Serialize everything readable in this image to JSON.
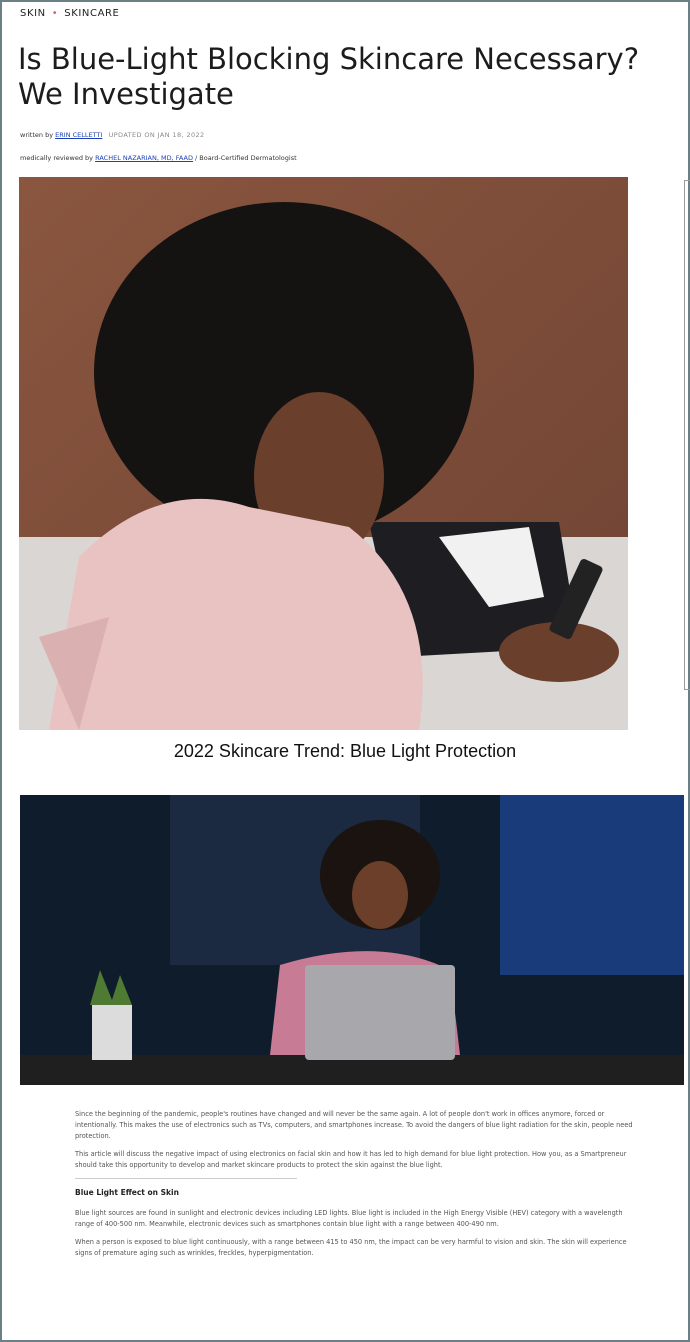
{
  "breadcrumb": {
    "item1": "SKIN",
    "sep": "•",
    "item2": "SKINCARE"
  },
  "article": {
    "title": "Is Blue-Light Blocking Skincare Necessary? We Investigate",
    "written_by_label": "written by",
    "author": "ERIN CELLETTI",
    "updated": "UPDATED ON JAN 18, 2022",
    "reviewed_label": "medically reviewed by",
    "reviewer": "RACHEL NAZARIAN, MD, FAAD",
    "reviewer_title": "/ Board-Certified Dermatologist",
    "hero_caption": "2022 Skincare Trend: Blue Light Protection",
    "para1": "Since the beginning of the pandemic, people's routines have changed and will never be the same again. A lot of people don't work in offices anymore, forced or intentionally. This makes the use of electronics such as TVs, computers, and smartphones increase. To avoid the dangers of blue light radiation for the skin, people need protection.",
    "para2": "This article will discuss the negative impact of using electronics on facial skin and how it has led to high demand for blue light protection. How you, as a Smartpreneur should take this opportunity to develop and market skincare products to protect the skin against the blue light.",
    "subheading": "Blue Light Effect on Skin",
    "para3": "Blue light sources are found in sunlight and electronic devices including LED lights. Blue light is included in the High Energy Visible (HEV) category with a wavelength range of 400-500 nm. Meanwhile, electronic devices such as smartphones contain blue light with a range between 400-490 nm.",
    "para4": "When a person is exposed to blue light continuously, with a range between 415 to 450 nm, the impact can be very harmful to vision and skin. The skin will experience signs of premature aging such as wrinkles, freckles, hyperpigmentation."
  }
}
